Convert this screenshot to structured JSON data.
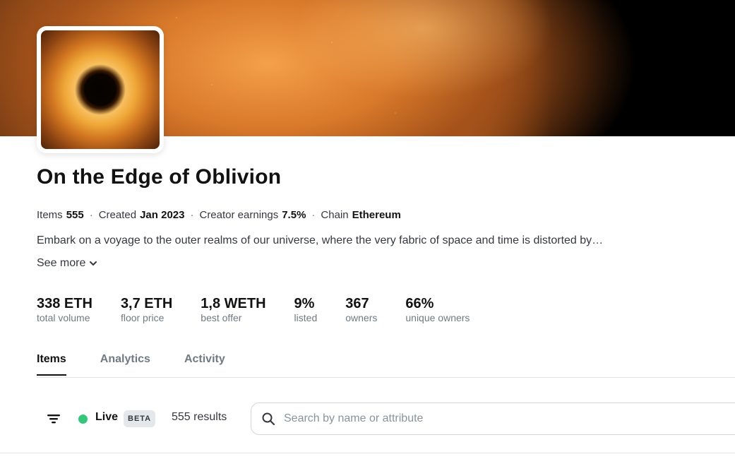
{
  "collection": {
    "name": "On the Edge of Oblivion",
    "meta": {
      "items_label": "Items",
      "items_value": "555",
      "created_label": "Created",
      "created_value": "Jan 2023",
      "earnings_label": "Creator earnings",
      "earnings_value": "7.5%",
      "chain_label": "Chain",
      "chain_value": "Ethereum",
      "separator": "·"
    },
    "description": "Embark on a voyage to the outer realms of our universe, where the very fabric of space and time is distorted by…",
    "see_more_label": "See more",
    "see_more_icon": "chevron-down-icon"
  },
  "stats": [
    {
      "value": "338 ETH",
      "label": "total volume"
    },
    {
      "value": "3,7 ETH",
      "label": "floor price"
    },
    {
      "value": "1,8 WETH",
      "label": "best offer"
    },
    {
      "value": "9%",
      "label": "listed"
    },
    {
      "value": "367",
      "label": "owners"
    },
    {
      "value": "66%",
      "label": "unique owners"
    }
  ],
  "tabs": [
    {
      "label": "Items",
      "active": true
    },
    {
      "label": "Analytics",
      "active": false
    },
    {
      "label": "Activity",
      "active": false
    }
  ],
  "toolbar": {
    "filter_icon": "filter-icon",
    "live_label": "Live",
    "live_color": "#34c77b",
    "beta_label": "BETA",
    "results_text": "555 results",
    "search_icon": "search-icon",
    "search_placeholder": "Search by name or attribute",
    "search_value": ""
  }
}
